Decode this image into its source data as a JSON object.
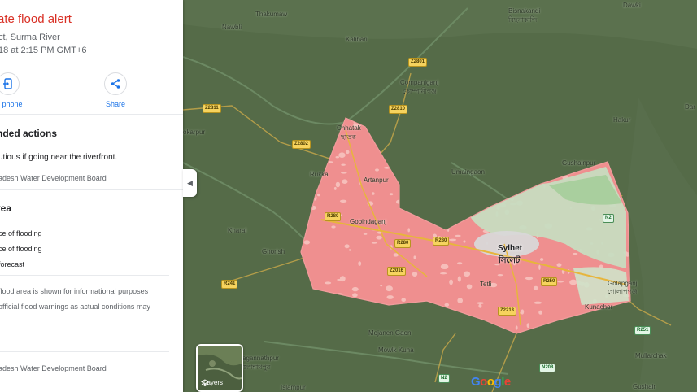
{
  "panel": {
    "title": "rate flood alert",
    "subtitle_location": "ct, Surma River",
    "subtitle_time": "18 at 2:15 PM GMT+6",
    "actions": [
      {
        "label": "to phone",
        "icon": "send-to-phone-icon"
      },
      {
        "label": "Share",
        "icon": "share-icon"
      }
    ],
    "recommended": {
      "heading": "nded actions",
      "text": "utious if going near the riverfront.",
      "source": "adesh Water Development Board"
    },
    "area": {
      "heading": "rea",
      "legend": [
        "ce of flooding",
        "ce of flooding",
        "forecast"
      ],
      "disclaimer_1": "flood area is shown for informational purposes",
      "disclaimer_2": "official flood warnings as actual conditions may"
    },
    "footer_source": "adesh Water Development Board"
  },
  "map": {
    "places": {
      "thakumaw": "Thakumaw",
      "bisnakandi": "Bisnakandi",
      "bisnakandi_bn": "বিছনাকান্দি",
      "dawki": "Dawki",
      "kalibari": "Kalibari",
      "nawbli": "Nawbli",
      "companiganj": "Companiganj",
      "companiganj_bn": "কোম্পানীগঞ্জ",
      "chhatak": "Chhatak",
      "chhatak_bn": "ছাতক",
      "jokarpur": "okarpur",
      "rukka": "Rukka",
      "artanpur": "Artanpur",
      "umaingaon": "Umaingaon",
      "gushainpur": "Gushainpur",
      "hakur": "Hakur",
      "dar": "Dar",
      "gobindaganj": "Gobindaganj",
      "kharal": "Kharal",
      "ghorash": "Ghorish",
      "sylhet": "Sylhet",
      "sylhet_bn": "সিলেট",
      "tetli": "Tetli",
      "golapganj": "Golapganj",
      "golapganj_bn": "গোলাপগঞ্জ",
      "kunachor": "Kunachor",
      "mojanen": "Mojanen Gaon",
      "mowlk": "Mowlk Kuna",
      "jagannathpur": "agannathpur",
      "jagannathpur_bn": "জগন্নাথপুর",
      "mullarchak": "Mullarchak",
      "gushair": "Gushair",
      "islampur": "Islampur"
    },
    "roads": {
      "z2801": "Z2801",
      "z2811": "Z2811",
      "z2810": "Z2810",
      "z2802": "Z2802",
      "r280a": "R280",
      "r280b": "R280",
      "r280c": "R280",
      "z2016": "Z2016",
      "r250": "R250",
      "z2213": "Z2213",
      "r241": "R241",
      "n2a": "N2",
      "n2b": "N2",
      "n208": "N208",
      "r251": "R251"
    },
    "layers_label": "Layers",
    "google_logo": "Google",
    "colors": {
      "flood": "#ef8f8f",
      "flood_light": "#f4b9b5",
      "land": "#556b48",
      "river": "#6c8a63"
    }
  }
}
